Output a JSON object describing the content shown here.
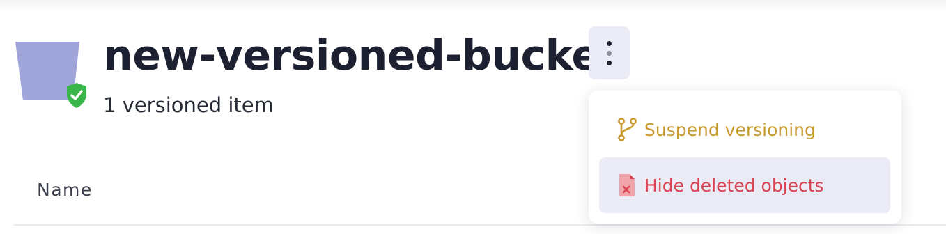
{
  "bucket": {
    "name": "new-versioned-bucket",
    "subtitle": "1 versioned item"
  },
  "table": {
    "columns": [
      "Name"
    ]
  },
  "menu": {
    "items": [
      {
        "label": "Suspend versioning",
        "icon": "git-branch-icon",
        "color": "#c99a2e"
      },
      {
        "label": "Hide deleted objects",
        "icon": "file-delete-icon",
        "color": "#d94352"
      }
    ]
  },
  "colors": {
    "bucket_icon": "#a0a5da",
    "shield": "#39b54a",
    "title": "#1c2030",
    "highlight": "#ebebf6"
  },
  "icons": {
    "bucket": "bucket-icon",
    "shield": "verified-shield-icon",
    "more": "more-vertical-icon"
  }
}
